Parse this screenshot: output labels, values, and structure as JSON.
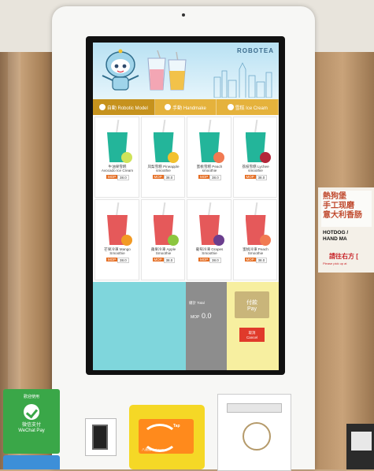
{
  "brand": "ROBOTEA",
  "tabs": [
    {
      "label": "自動 Robotic Model",
      "active": true
    },
    {
      "label": "手動 Handmake",
      "active": false
    },
    {
      "label": "雪糕 Ice Cream",
      "active": false
    }
  ],
  "products": [
    {
      "name": "牛油果雪糕\nAvocado Ice Cream",
      "price": "38.0",
      "cup_color": "#23b59a",
      "fruit_color": "#cfe35a"
    },
    {
      "name": "凤梨雪糕 Pineapple\nsmoothie",
      "price": "38.0",
      "cup_color": "#23b59a",
      "fruit_color": "#f2c12e"
    },
    {
      "name": "蜜桃雪糕 Peach\nsmoothie",
      "price": "38.0",
      "cup_color": "#23b59a",
      "fruit_color": "#f17a52"
    },
    {
      "name": "荔枝雪糕 Lychee\nsmoothie",
      "price": "38.0",
      "cup_color": "#23b59a",
      "fruit_color": "#b3263a"
    },
    {
      "name": "芒果冷凍 Mango\nSmoothie",
      "price": "38.0",
      "cup_color": "#e5595a",
      "fruit_color": "#f29a24"
    },
    {
      "name": "蘋果冷凍 Apple\nSmoothie",
      "price": "38.0",
      "cup_color": "#e5595a",
      "fruit_color": "#8cc63f"
    },
    {
      "name": "葡萄冷凍 Grapes\nSmoothie",
      "price": "38.0",
      "cup_color": "#e5595a",
      "fruit_color": "#6b3e8e"
    },
    {
      "name": "蜜桃冷凍 Peach\nSmoothie",
      "price": "38.0",
      "cup_color": "#e5595a",
      "fruit_color": "#f17a52"
    }
  ],
  "order": {
    "label": "總計 Total",
    "currency": "MOP",
    "amount": "0.0"
  },
  "pay_label": "付款\nPay",
  "cancel_label": "取消\nCancel",
  "wechat": {
    "top": "歡迎使用",
    "name": "微信支付\nWeChat Pay"
  },
  "octopus": {
    "brand": "八達通 Octopus",
    "badge": "Tap"
  },
  "signboard": {
    "line1": "熱狗堡\n手工现磨\n意大利香肠",
    "line2": "HOTDOG / \nHAND MA",
    "line3": "請往右方 [",
    "line4": "Please pick up at"
  }
}
